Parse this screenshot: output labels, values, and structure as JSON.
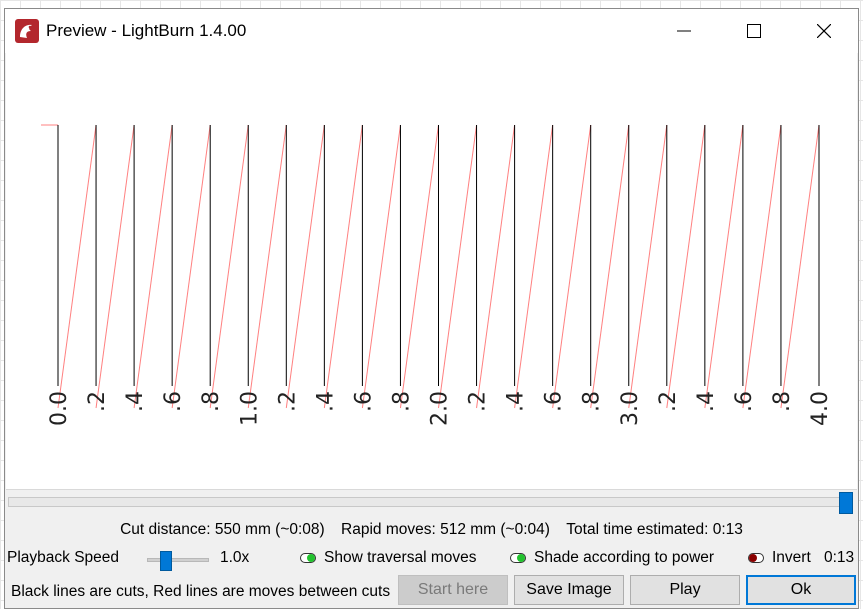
{
  "window": {
    "title": "Preview - LightBurn 1.4.00",
    "minimize_icon": "minimize-icon",
    "maximize_icon": "maximize-icon",
    "close_icon": "close-icon"
  },
  "preview": {
    "cut_line_count": 21,
    "axis_labels": [
      "0.0",
      ".2",
      ".4",
      ".6",
      ".8",
      "1.0",
      ".2",
      ".4",
      ".6",
      ".8",
      "2.0",
      ".2",
      ".4",
      ".6",
      ".8",
      "3.0",
      ".2",
      ".4",
      ".6",
      ".8",
      "4.0"
    ],
    "cut_color": "#000000",
    "traversal_color": "#ff8080"
  },
  "timeline": {
    "position_fraction": 1.0
  },
  "stats": {
    "cut_distance": "Cut distance: 550 mm (~0:08)",
    "rapid_moves": "Rapid moves: 512 mm (~0:04)",
    "total_time": "Total time estimated: 0:13"
  },
  "controls": {
    "playback_speed_label": "Playback Speed",
    "playback_speed_value": "1.0x",
    "playback_speed_fraction": 0.25,
    "show_traversal_label": "Show traversal moves",
    "show_traversal_on": true,
    "shade_power_label": "Shade according to power",
    "shade_power_on": true,
    "invert_label": "Invert",
    "invert_on": false,
    "elapsed_time": "0:13",
    "toggle_on_color": "#22c32e",
    "toggle_off_color": "#8b0000"
  },
  "footer": {
    "hint": "Black lines are cuts, Red lines are moves between cuts",
    "start_here_label": "Start here",
    "save_image_label": "Save Image",
    "play_label": "Play",
    "ok_label": "Ok"
  }
}
